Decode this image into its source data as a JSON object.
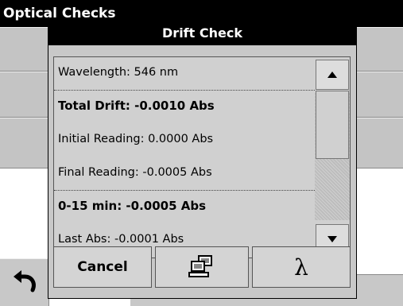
{
  "background": {
    "title": "Optical Checks"
  },
  "dialog": {
    "title": "Drift Check",
    "items": [
      {
        "text": "Wavelength: 546 nm",
        "bold": false
      },
      {
        "text": "Total Drift: -0.0010 Abs",
        "bold": true
      },
      {
        "text": "Initial Reading:  0.0000 Abs",
        "bold": false
      },
      {
        "text": "Final Reading: -0.0005 Abs",
        "bold": false
      },
      {
        "text": "0-15 min: -0.0005 Abs",
        "bold": true
      },
      {
        "text": "Last Abs: -0.0001 Abs",
        "bold": false
      }
    ],
    "buttons": {
      "cancel": "Cancel",
      "lambda": "λ"
    }
  },
  "icons": {
    "back": "back-arrow-icon",
    "computer": "computer-icon",
    "scroll_up": "triangle-up-icon",
    "scroll_down": "triangle-down-icon"
  }
}
